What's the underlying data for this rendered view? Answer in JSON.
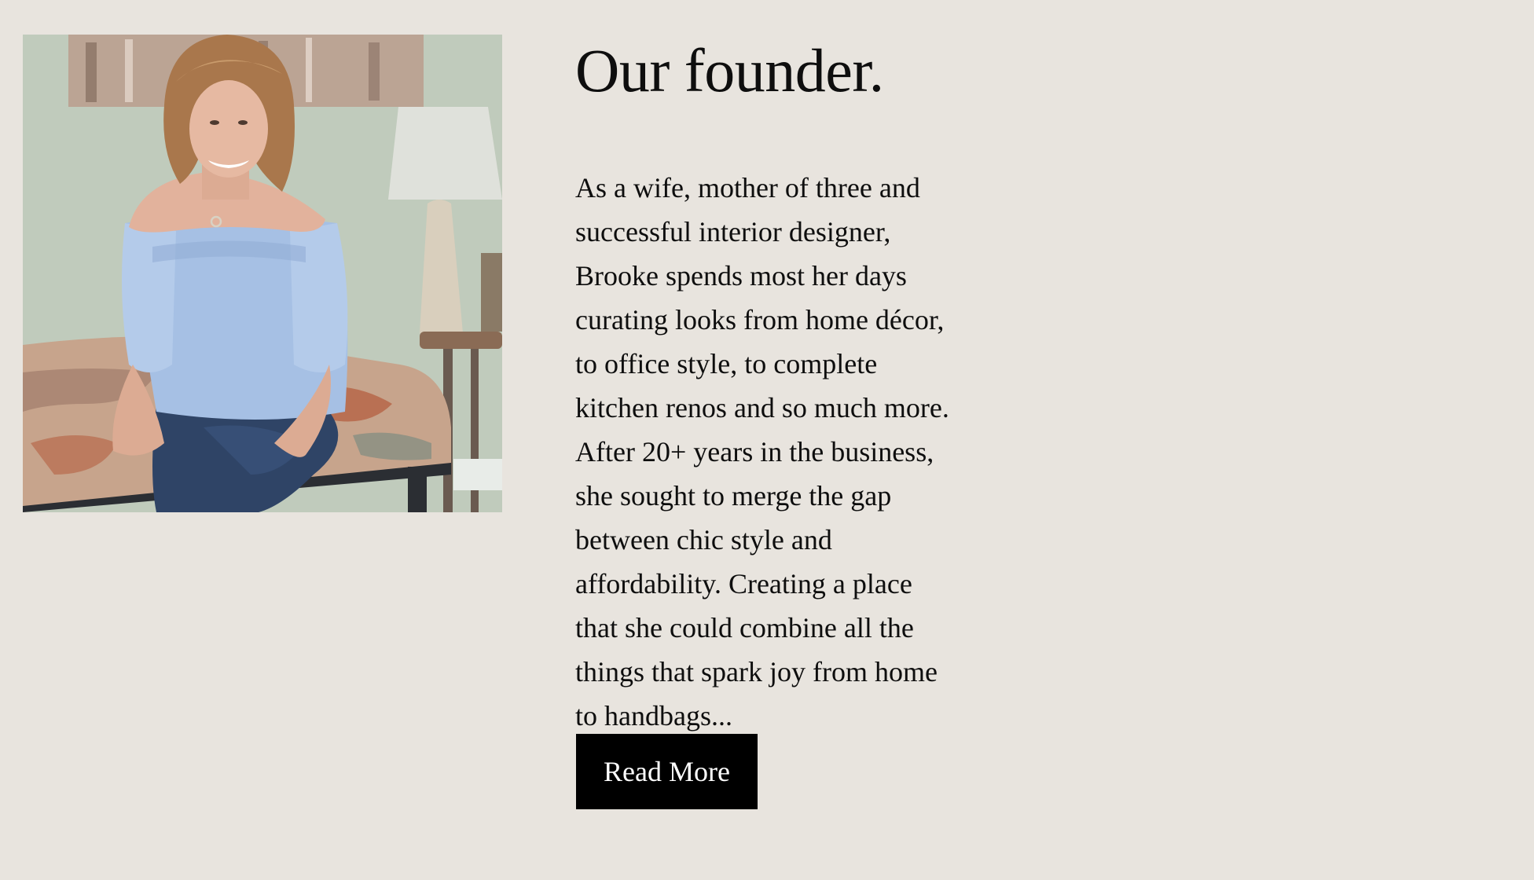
{
  "founder": {
    "photo_description": "",
    "title": "Our founder.",
    "body_lines": [
      "As a wife, mother of three and",
      "successful interior designer,",
      "Brooke spends most her days",
      "curating looks from home décor,",
      "to office style, to complete",
      "kitchen renos and so much more.",
      "After 20+ years in the business,",
      "she sought to merge the gap",
      "between chic style and",
      "affordability. Creating a place",
      "that she could combine all the",
      "things that spark joy from home",
      "to handbags..."
    ],
    "read_more_label": "Read More"
  }
}
